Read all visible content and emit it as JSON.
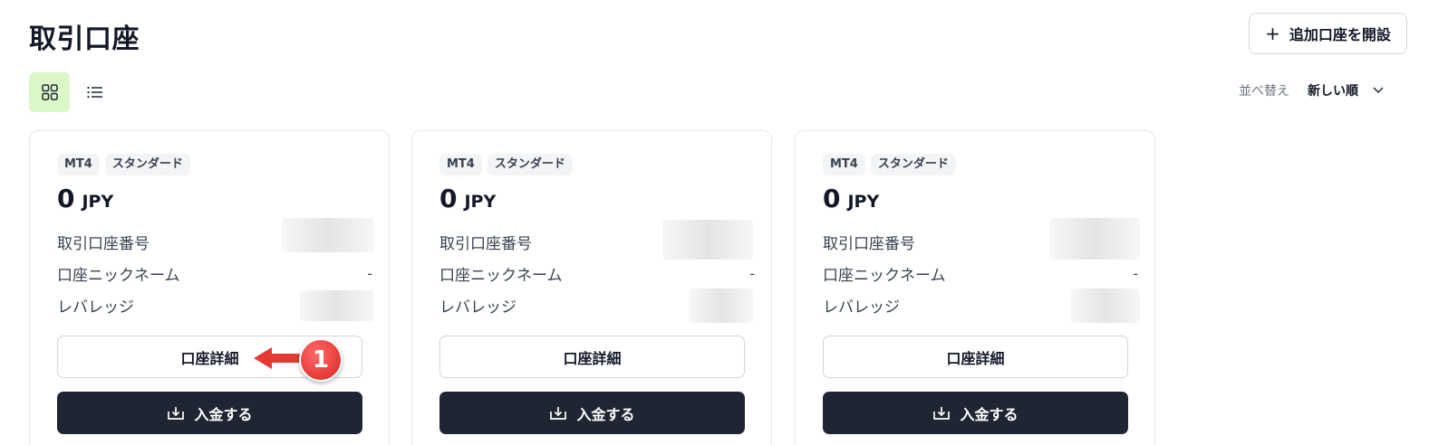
{
  "page": {
    "title": "取引口座"
  },
  "header": {
    "open_account_label": "追加口座を開設",
    "open_account_icon": "plus-icon"
  },
  "view": {
    "grid_icon": "grid-icon",
    "list_icon": "list-icon",
    "active": "grid"
  },
  "sort": {
    "label": "並べ替え",
    "value": "新しい順"
  },
  "field_labels": {
    "account_number": "取引口座番号",
    "nickname": "口座ニックネーム",
    "leverage": "レバレッジ"
  },
  "cards": [
    {
      "platform": "MT4",
      "type": "スタンダード",
      "amount": "0",
      "currency": "JPY",
      "account_number": "",
      "nickname": "-",
      "leverage": "",
      "detail_label": "口座詳細",
      "deposit_label": "入金する"
    },
    {
      "platform": "MT4",
      "type": "スタンダード",
      "amount": "0",
      "currency": "JPY",
      "account_number": "",
      "nickname": "-",
      "leverage": "",
      "detail_label": "口座詳細",
      "deposit_label": "入金する"
    },
    {
      "platform": "MT4",
      "type": "スタンダード",
      "amount": "0",
      "currency": "JPY",
      "account_number": "",
      "nickname": "-",
      "leverage": "",
      "detail_label": "口座詳細",
      "deposit_label": "入金する"
    }
  ],
  "annotation": {
    "number": "1",
    "color": "#e53935"
  },
  "colors": {
    "accent_green": "#dcf7c7",
    "primary_dark": "#1f2532"
  }
}
